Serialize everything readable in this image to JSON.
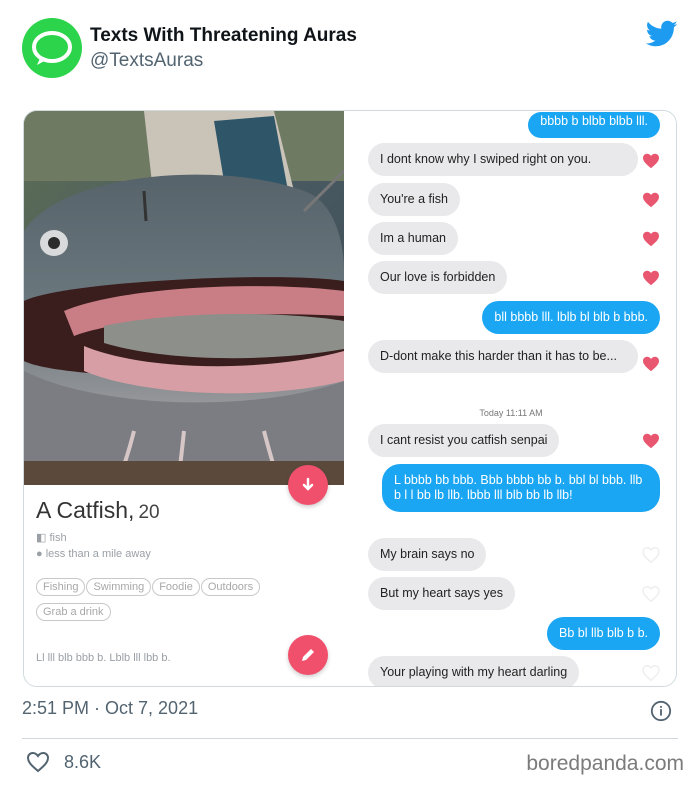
{
  "account": {
    "display_name": "Texts With Threatening Auras",
    "handle": "@TextsAuras",
    "avatar_icon": "message-bubble-icon",
    "avatar_color": "#2bd44a",
    "platform_icon": "twitter-bird-icon",
    "platform_color": "#1d9bf0"
  },
  "profile": {
    "name": "A Catfish,",
    "age": "20",
    "job": "fish",
    "distance": "less than a mile away",
    "tags": [
      "Fishing",
      "Swimming",
      "Foodie",
      "Outdoors",
      "Grab a drink"
    ],
    "bio": "Ll lll blb bbb b. Lblb lll lbb b.",
    "accent_color": "#f0506b"
  },
  "chat": {
    "messages": [
      {
        "side": "sent",
        "text": "bbbb b blbb blbb lll."
      },
      {
        "side": "received",
        "text": "I dont know why I swiped right on you."
      },
      {
        "side": "received",
        "text": "You're a fish"
      },
      {
        "side": "received",
        "text": "Im a human"
      },
      {
        "side": "received",
        "text": "Our love is forbidden"
      },
      {
        "side": "sent",
        "text": "bll bbbb lll. lblb bl blb b bbb."
      },
      {
        "side": "received",
        "text": "D-dont make this harder than it has to be..."
      },
      {
        "side": "received",
        "text": "I cant resist you catfish senpai"
      },
      {
        "side": "sent",
        "text": "L bbbb bb bbb. Bbb bbbb bb b. bbl bl bbb. llb b l l bb lb llb. lbbb lll blb bb lb llb!"
      },
      {
        "side": "received",
        "text": "My brain says no"
      },
      {
        "side": "received",
        "text": "But my heart says yes"
      },
      {
        "side": "sent",
        "text": "Bb bl llb blb b b."
      },
      {
        "side": "received",
        "text": "Your playing with my heart darling"
      }
    ],
    "timestamp": "Today 11:11 AM",
    "sent_color": "#1ba6f4",
    "received_color": "#e9e9eb"
  },
  "footer": {
    "time": "2:51 PM · Oct 7, 2021",
    "likes": "8.6K",
    "watermark": "boredpanda.com"
  }
}
